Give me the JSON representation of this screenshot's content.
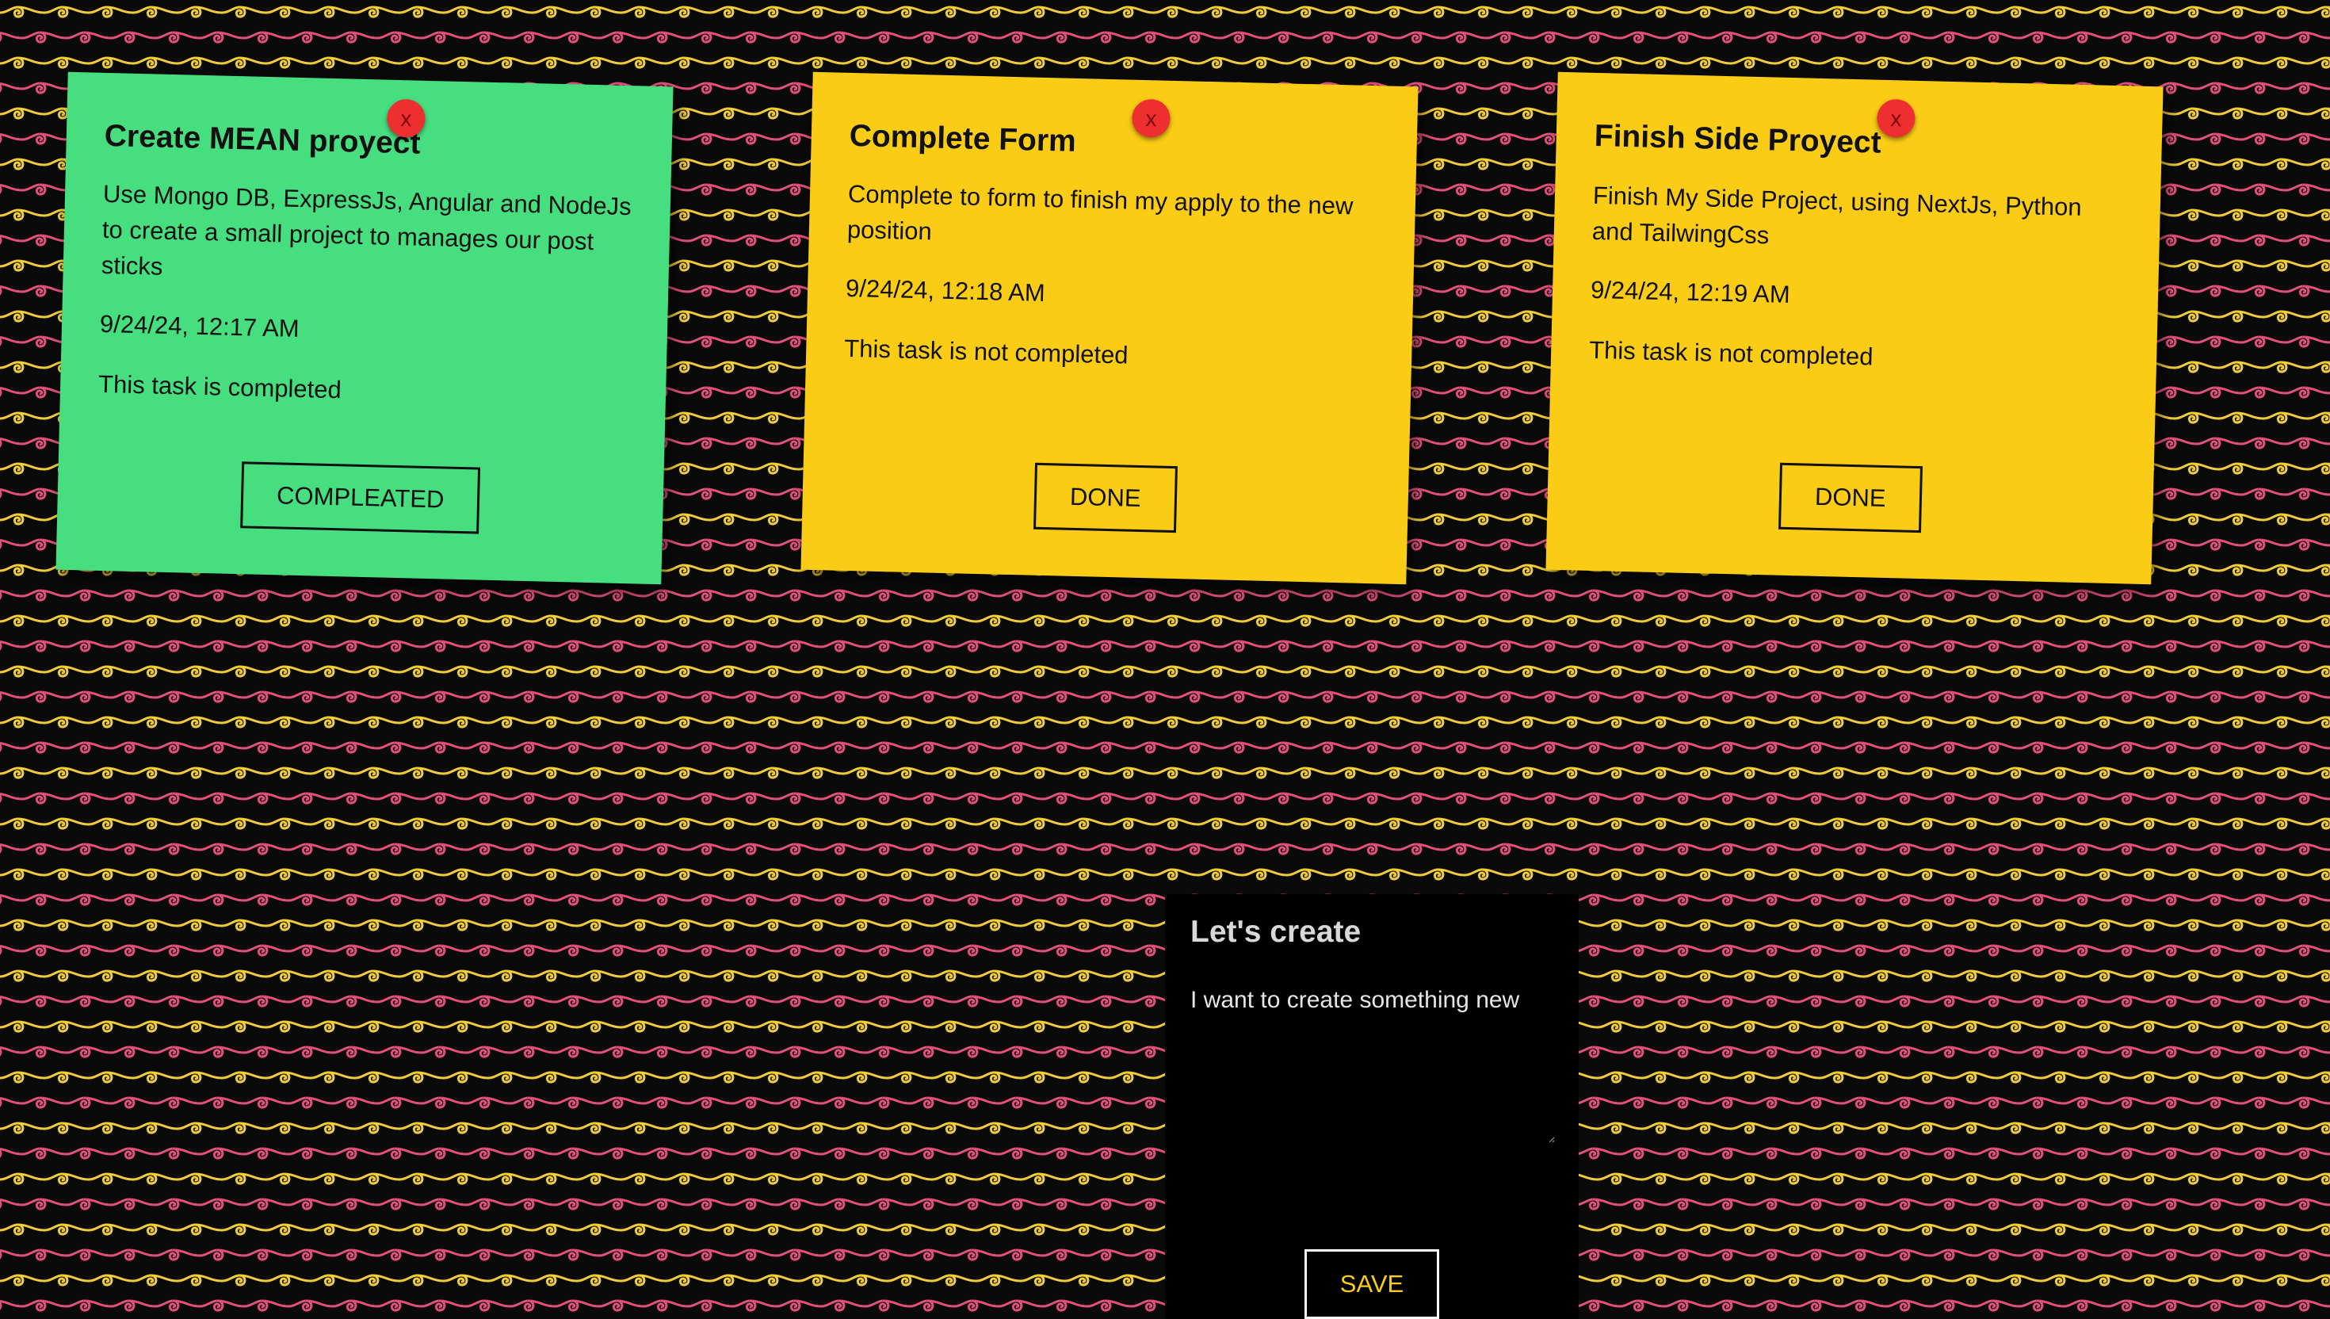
{
  "notes": [
    {
      "title": "Create MEAN proyect",
      "description": "Use Mongo DB, ExpressJs, Angular and NodeJs to create a small project to manages our post sticks",
      "date": "9/24/24, 12:17 AM",
      "status": "This task is completed",
      "button_label": "COMPLEATED",
      "close_label": "x",
      "color": "#47de80"
    },
    {
      "title": "Complete Form",
      "description": "Complete to form to finish my apply to the new position",
      "date": "9/24/24, 12:18 AM",
      "status": "This task is not completed",
      "button_label": "DONE",
      "close_label": "x",
      "color": "#facc15"
    },
    {
      "title": "Finish Side Proyect",
      "description": "Finish My Side Project, using NextJs, Python and TailwingCss",
      "date": "9/24/24, 12:19 AM",
      "status": "This task is not completed",
      "button_label": "DONE",
      "close_label": "x",
      "color": "#facc15"
    }
  ],
  "create": {
    "title": "Let's create",
    "textarea_value": "I want to create something new",
    "save_label": "SAVE"
  },
  "background": {
    "pattern": "spiral-waves",
    "colors": [
      "#0a0a0a",
      "#e0507a",
      "#f2cc3a"
    ]
  }
}
